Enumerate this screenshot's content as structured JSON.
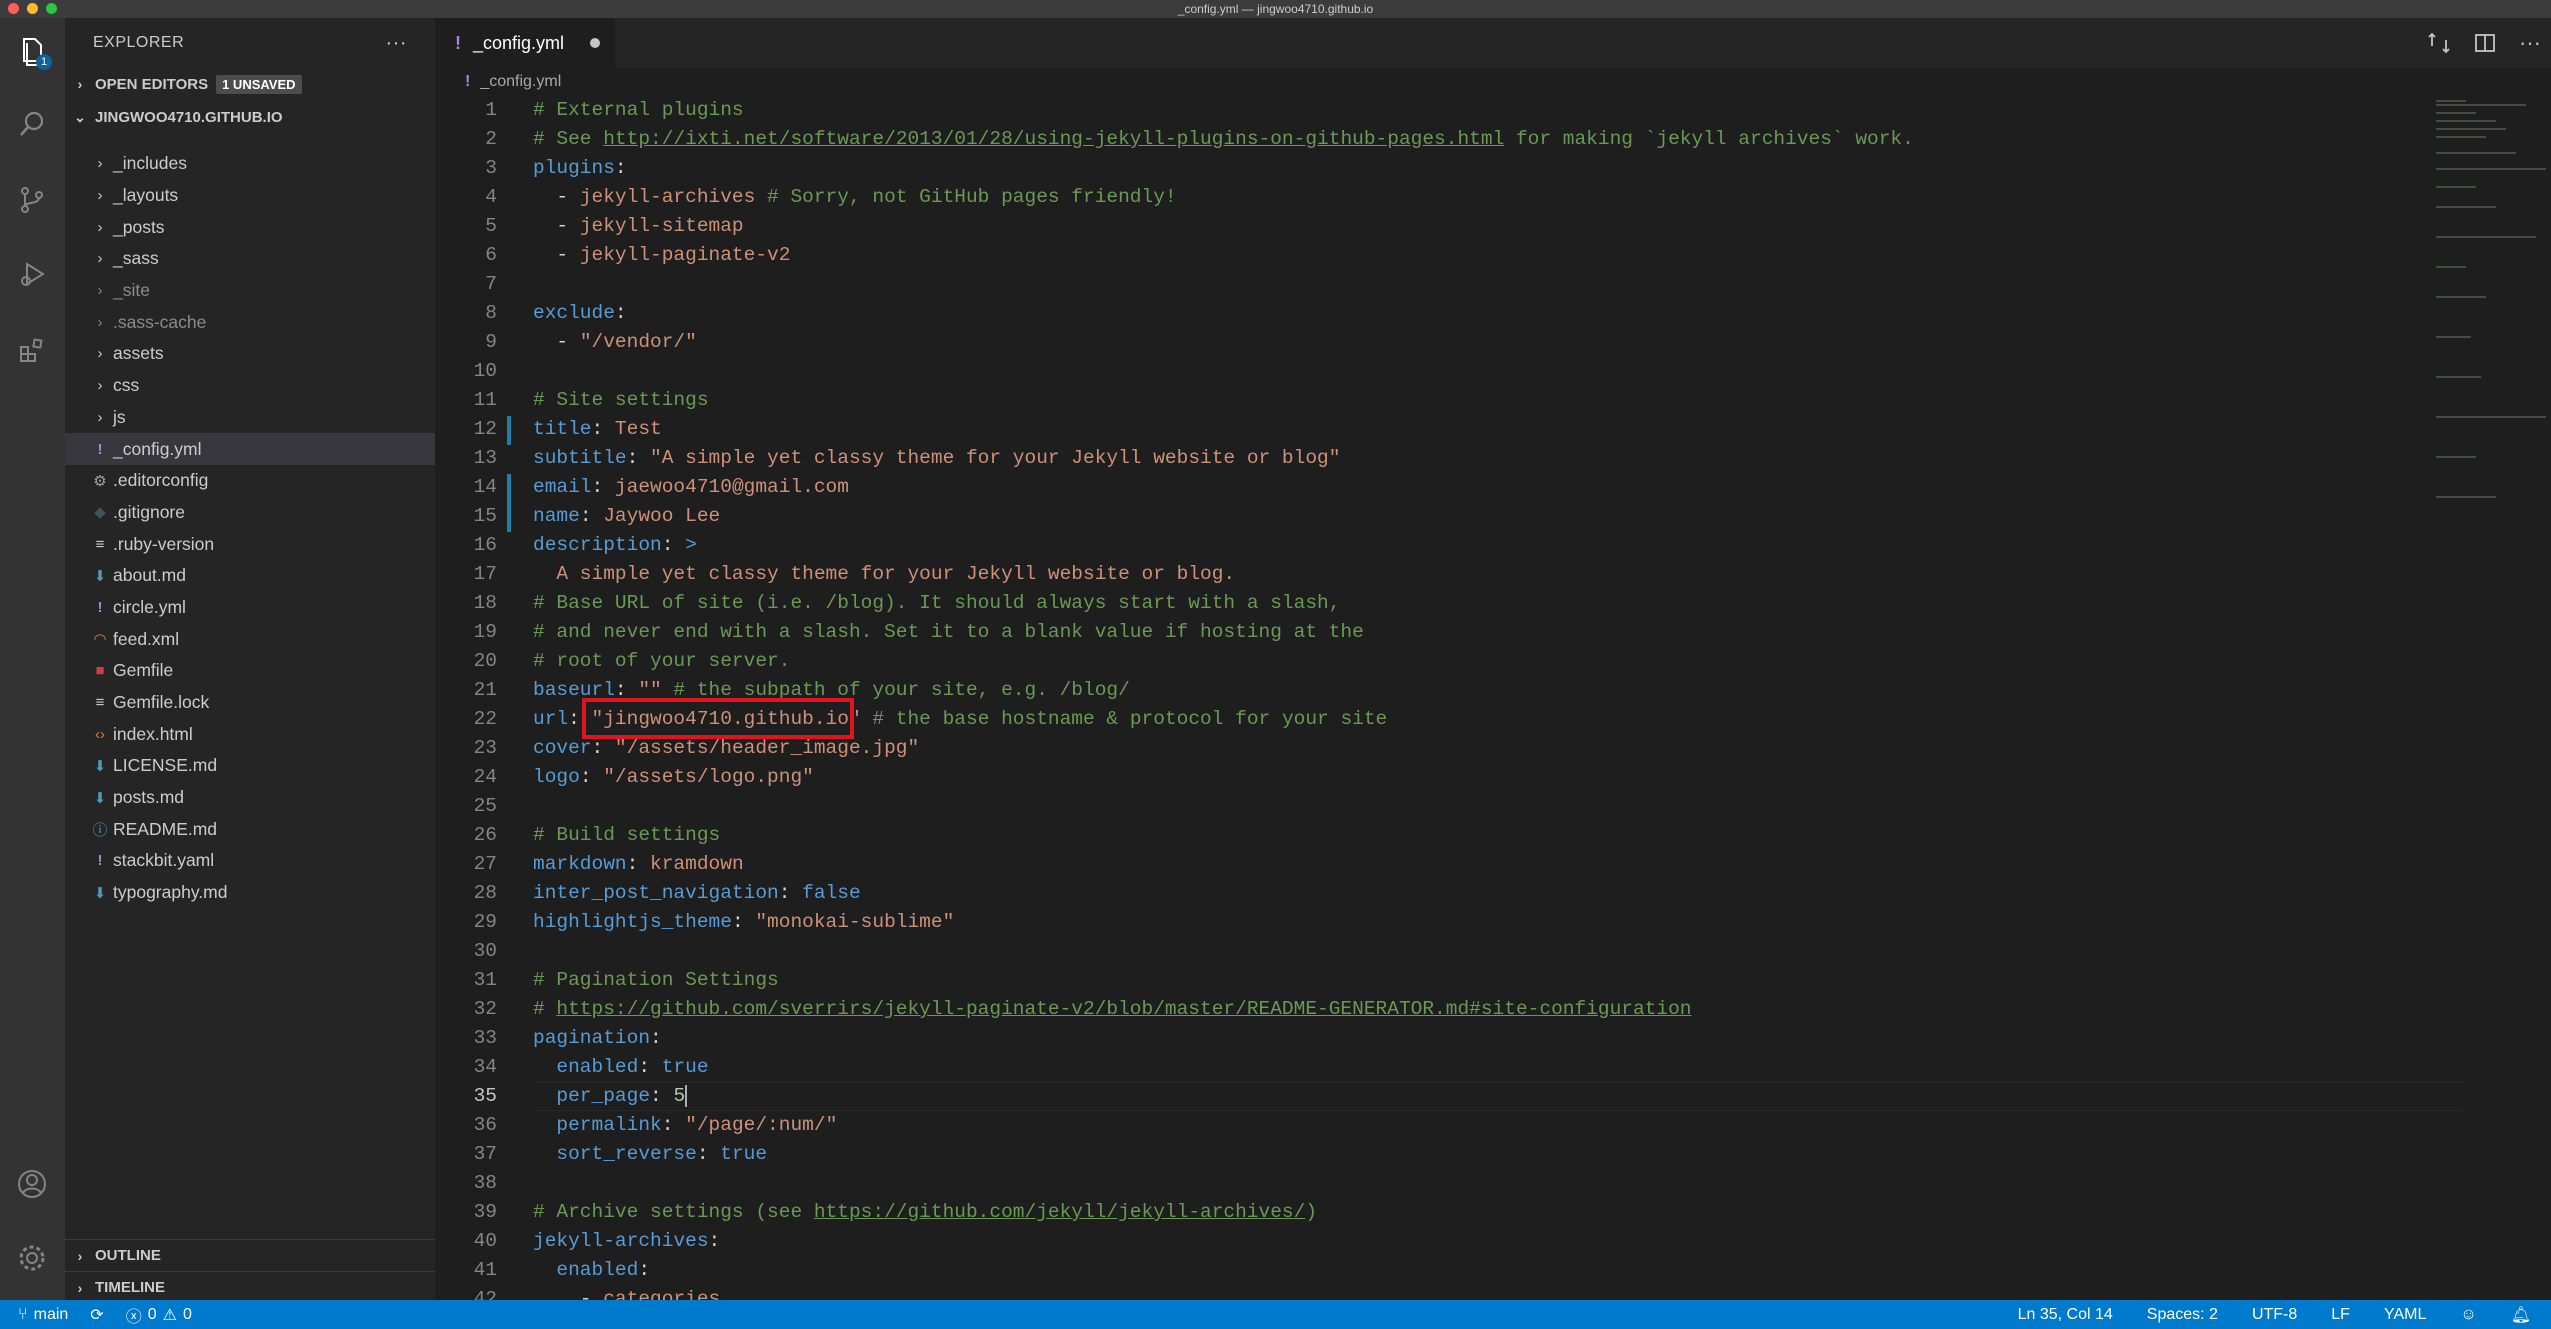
{
  "window": {
    "title": "_config.yml — jingwoo4710.github.io"
  },
  "activity": {
    "explorer_badge": "1"
  },
  "sidebar": {
    "title": "EXPLORER",
    "more": "···",
    "open_editors": "OPEN EDITORS",
    "unsaved_badge": "1 UNSAVED",
    "workspace": "JINGWOO4710.GITHUB.IO",
    "folders": [
      "_includes",
      "_layouts",
      "_posts",
      "_sass",
      "_site",
      ".sass-cache",
      "assets",
      "css",
      "js"
    ],
    "files": [
      "_config.yml",
      ".editorconfig",
      ".gitignore",
      ".ruby-version",
      "about.md",
      "circle.yml",
      "feed.xml",
      "Gemfile",
      "Gemfile.lock",
      "index.html",
      "LICENSE.md",
      "posts.md",
      "README.md",
      "stackbit.yaml",
      "typography.md"
    ],
    "outline": "OUTLINE",
    "timeline": "TIMELINE"
  },
  "tab": {
    "label": "_config.yml",
    "excl": "!"
  },
  "breadcrumb": {
    "file": "_config.yml"
  },
  "editor": {
    "line_numbers": [
      "1",
      "2",
      "3",
      "4",
      "5",
      "6",
      "7",
      "8",
      "9",
      "10",
      "11",
      "12",
      "13",
      "14",
      "15",
      "16",
      "17",
      "18",
      "19",
      "20",
      "21",
      "22",
      "23",
      "24",
      "25",
      "26",
      "27",
      "28",
      "29",
      "30",
      "31",
      "32",
      "33",
      "34",
      "35",
      "36",
      "37",
      "38",
      "39",
      "40",
      "41",
      "42"
    ],
    "l1": "# External plugins",
    "l2a": "# See ",
    "l2b": "http://ixti.net/software/2013/01/28/using-jekyll-plugins-on-github-pages.html",
    "l2c": " for making `jekyll archives` work.",
    "l3": "plugins",
    "l4a": "jekyll-archives",
    "l4b": " # Sorry, not GitHub pages friendly!",
    "l5": "jekyll-sitemap",
    "l6": "jekyll-paginate-v2",
    "l8": "exclude",
    "l9": "\"/vendor/\"",
    "l11": "# Site settings",
    "l12k": "title",
    "l12v": "Test",
    "l13k": "subtitle",
    "l13v": "\"A simple yet classy theme for your Jekyll website or blog\"",
    "l14k": "email",
    "l14v": "jaewoo4710@gmail.com",
    "l15k": "name",
    "l15v": "Jaywoo Lee",
    "l16k": "description",
    "l16v": ">",
    "l17": "A simple yet classy theme for your Jekyll website or blog.",
    "l18": "# Base URL of site (i.e. /blog). It should always start with a slash,",
    "l19": "# and never end with a slash. Set it to a blank value if hosting at the",
    "l20": "# root of your server.",
    "l21k": "baseurl",
    "l21v": "\"\"",
    "l21c": " # the subpath of your site, e.g. /blog/",
    "l22k": "url",
    "l22v": "\"jingwoo4710.github.io\"",
    "l22c": " # the base hostname & protocol for your site",
    "l23k": "cover",
    "l23v": "\"/assets/header_image.jpg\"",
    "l24k": "logo",
    "l24v": "\"/assets/logo.png\"",
    "l26": "# Build settings",
    "l27k": "markdown",
    "l27v": "kramdown",
    "l28k": "inter_post_navigation",
    "l28v": "false",
    "l29k": "highlightjs_theme",
    "l29v": "\"monokai-sublime\"",
    "l31": "# Pagination Settings",
    "l32a": "# ",
    "l32b": "https://github.com/sverrirs/jekyll-paginate-v2/blob/master/README-GENERATOR.md#site-configuration",
    "l33k": "pagination",
    "l34k": "enabled",
    "l34v": "true",
    "l35k": "per_page",
    "l35v": "5",
    "l36k": "permalink",
    "l36v": "\"/page/:num/\"",
    "l37k": "sort_reverse",
    "l37v": "true",
    "l39a": "# Archive settings (see ",
    "l39b": "https://github.com/jekyll/jekyll-archives/",
    "l39c": ")",
    "l40k": "jekyll-archives",
    "l41k": "enabled",
    "l42": "categories"
  },
  "status": {
    "branch": "main",
    "errors": "0",
    "warnings": "0",
    "position": "Ln 35, Col 14",
    "spaces": "Spaces: 2",
    "encoding": "UTF-8",
    "eol": "LF",
    "language": "YAML"
  },
  "colors": {
    "accent": "#007acc",
    "highlight": "#e0141e"
  }
}
